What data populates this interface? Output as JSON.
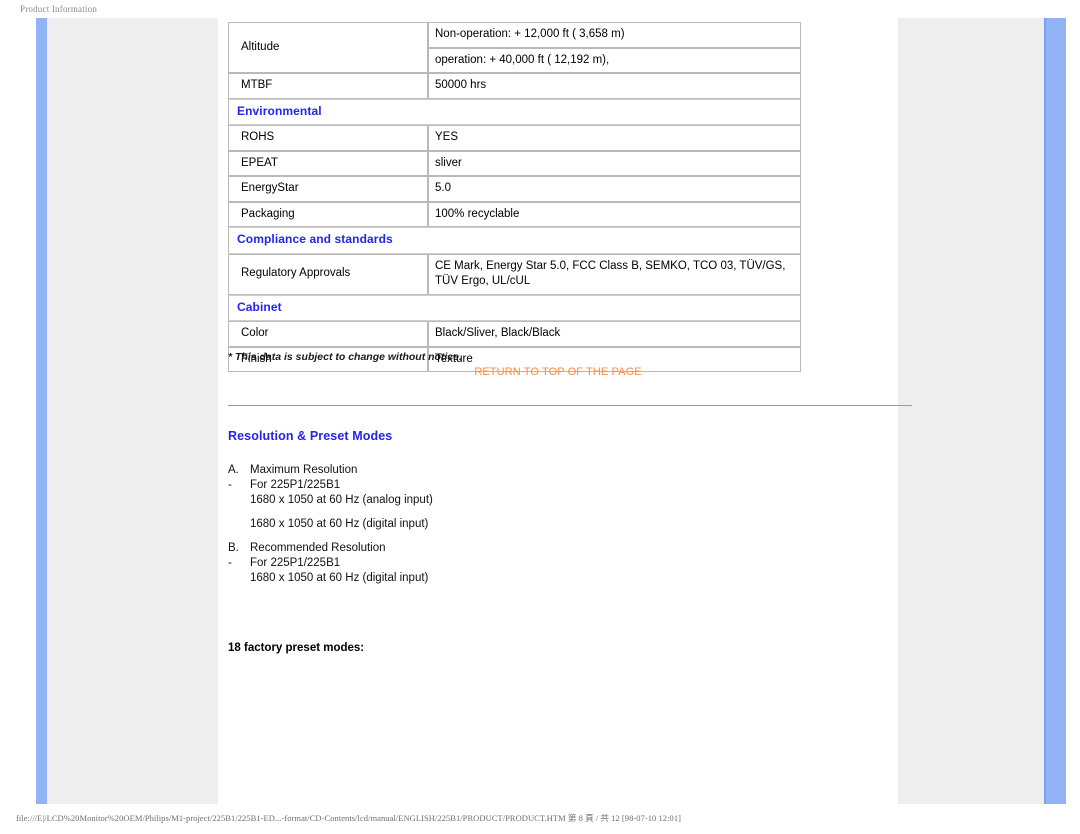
{
  "print": {
    "header": "Product Information",
    "footer": "file:///E|/LCD%20Monitor%20OEM/Philips/M1-project/225B1/225B1-ED...-format/CD-Contents/lcd/manual/ENGLISH/225B1/PRODUCT/PRODUCT.HTM 第 8 頁 / 共 12 [98-07-10 12:01]"
  },
  "colors": {
    "section_heading": "#2424ee",
    "link": "#ff8a3d",
    "rail": "#92b4f7",
    "panel": "#eeeeee"
  },
  "spec_table": {
    "rows": [
      {
        "type": "data",
        "label": "Altitude",
        "value": "Non-operation: + 12,000 ft ( 3,658 m)",
        "rowspan": 2
      },
      {
        "type": "data",
        "label": "",
        "value": "operation: + 40,000 ft ( 12,192 m),"
      },
      {
        "type": "data",
        "label": "MTBF",
        "value": "50000 hrs"
      },
      {
        "type": "section",
        "title": "Environmental"
      },
      {
        "type": "data",
        "label": "ROHS",
        "value": "YES"
      },
      {
        "type": "data",
        "label": "EPEAT",
        "value": "sliver"
      },
      {
        "type": "data",
        "label": "EnergyStar",
        "value": "5.0"
      },
      {
        "type": "data",
        "label": "Packaging",
        "value": "100% recyclable"
      },
      {
        "type": "section",
        "title": "Compliance and standards"
      },
      {
        "type": "data",
        "label": "Regulatory Approvals",
        "value": "CE Mark, Energy Star 5.0, FCC Class B, SEMKO, TCO 03, TÜV/GS, TÜV Ergo, UL/cUL"
      },
      {
        "type": "section",
        "title": "Cabinet"
      },
      {
        "type": "data",
        "label": "Color",
        "value": "Black/Sliver, Black/Black"
      },
      {
        "type": "data",
        "label": "Finish",
        "value": "Texture"
      }
    ],
    "cells": {
      "altitude_label": "Altitude",
      "altitude_value_1": "Non-operation: + 12,000 ft ( 3,658 m)",
      "altitude_value_2": "operation: + 40,000 ft ( 12,192 m),",
      "mtbf_label": "MTBF",
      "mtbf_value": "50000 hrs",
      "environmental_section": "Environmental",
      "rohs_label": "ROHS",
      "rohs_value": "YES",
      "epeat_label": "EPEAT",
      "epeat_value": "sliver",
      "energystar_label": "EnergyStar",
      "energystar_value": "5.0",
      "packaging_label": "Packaging",
      "packaging_value": "100% recyclable",
      "compliance_section": "Compliance and standards",
      "regulatory_label": "Regulatory Approvals",
      "regulatory_value": "CE Mark, Energy Star 5.0, FCC Class B, SEMKO, TCO 03, TÜV/GS, TÜV Ergo, UL/cUL",
      "cabinet_section": "Cabinet",
      "color_label": "Color",
      "color_value": "Black/Sliver, Black/Black",
      "finish_label": "Finish",
      "finish_value": "Texture"
    }
  },
  "note": "* This data is subject to change without notice.",
  "return_link": "RETURN TO TOP OF THE PAGE",
  "resolution": {
    "heading": "Resolution & Preset Modes",
    "a_marker": "A.",
    "a_title": "Maximum Resolution",
    "a_dash": "-",
    "a_model": "For 225P1/225B1",
    "a_line1": "1680 x 1050 at 60 Hz (analog input)",
    "a_line2": "1680 x 1050 at 60 Hz (digital input)",
    "b_marker": "B.",
    "b_title": "Recommended Resolution",
    "b_dash": "-",
    "b_model": "For 225P1/225B1",
    "b_line1": "1680 x 1050 at 60 Hz (digital input)",
    "preset_heading": "18 factory preset modes:"
  }
}
